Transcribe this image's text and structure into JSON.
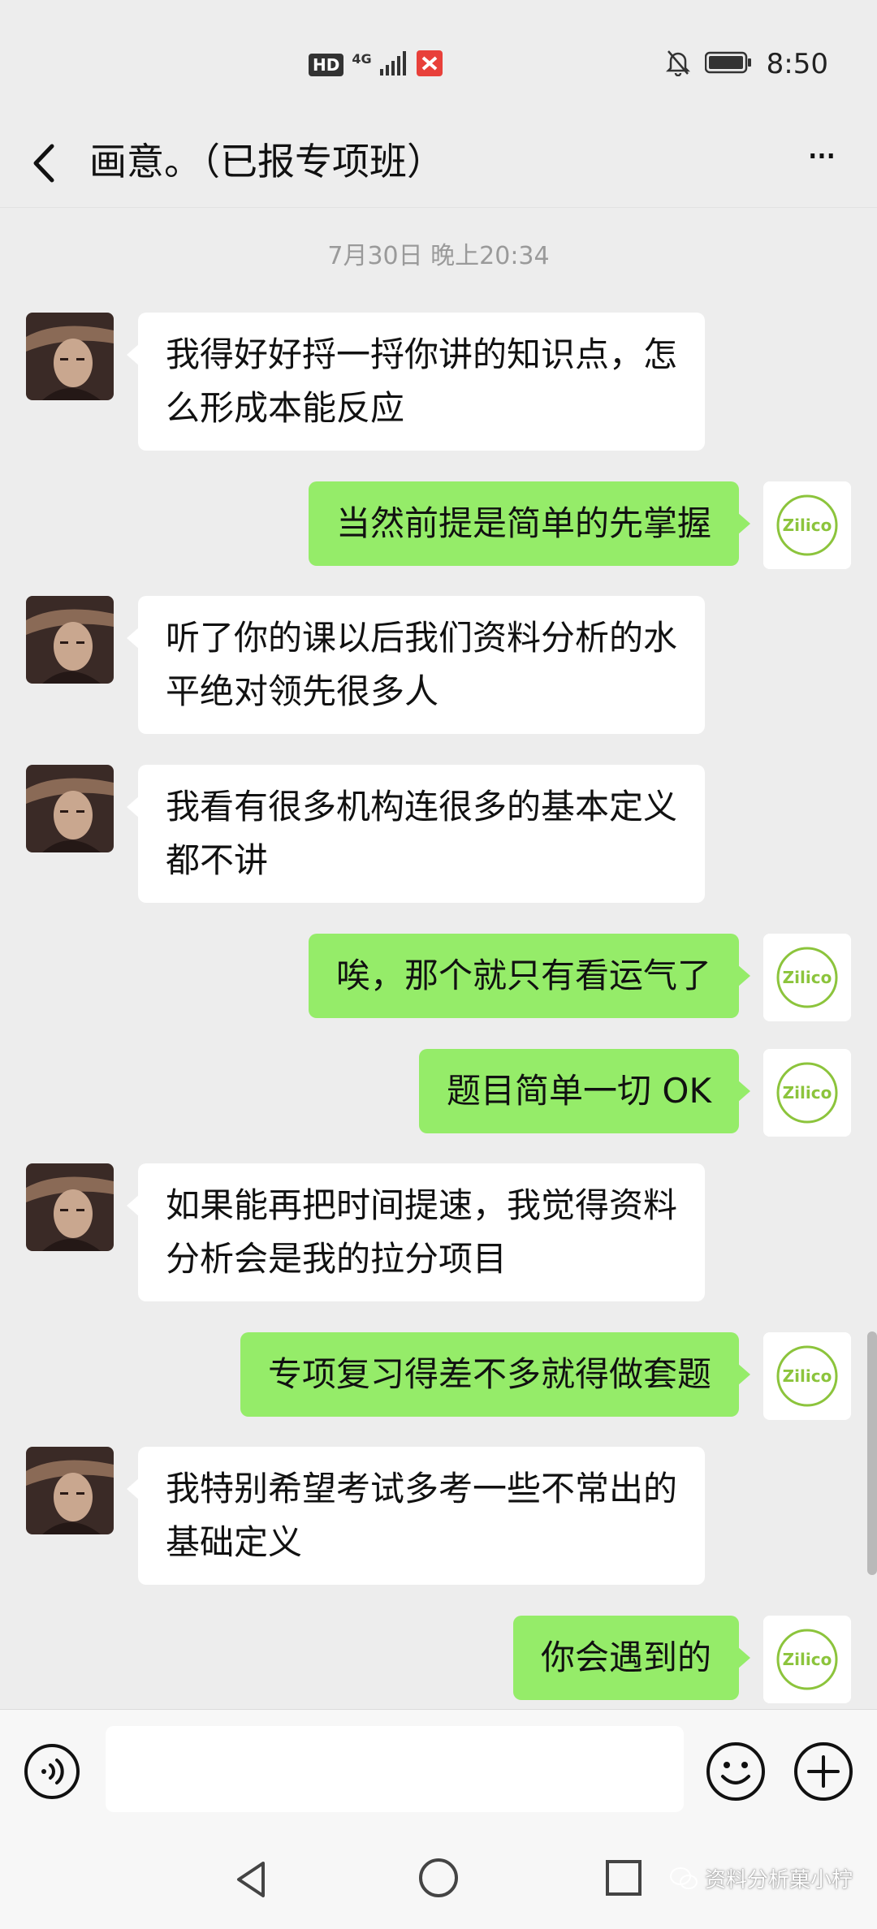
{
  "status_bar": {
    "hd_badge": "HD",
    "network_type": "4G",
    "time": "8:50",
    "icons": [
      "signal-icon",
      "shield-app-icon",
      "bell-off-icon",
      "battery-icon"
    ]
  },
  "header": {
    "title": "画意。（已报专项班）",
    "back_icon": "chevron-left-icon",
    "more_icon": "more-dots-icon",
    "more_label": "···"
  },
  "chat": {
    "timestamp": "7月30日 晚上20:34",
    "messages": [
      {
        "side": "in",
        "lines": [
          "我得好好捋一捋你讲的知识点，怎",
          "么形成本能反应"
        ]
      },
      {
        "side": "out",
        "lines": [
          "当然前提是简单的先掌握"
        ]
      },
      {
        "side": "in",
        "lines": [
          "听了你的课以后我们资料分析的水",
          "平绝对领先很多人"
        ]
      },
      {
        "side": "in",
        "lines": [
          "我看有很多机构连很多的基本定义",
          "都不讲"
        ]
      },
      {
        "side": "out",
        "lines": [
          "唉，那个就只有看运气了"
        ]
      },
      {
        "side": "out",
        "lines": [
          "题目简单一切 OK"
        ]
      },
      {
        "side": "in",
        "lines": [
          "如果能再把时间提速，我觉得资料",
          "分析会是我的拉分项目"
        ]
      },
      {
        "side": "out",
        "lines": [
          "专项复习得差不多就得做套题"
        ]
      },
      {
        "side": "in",
        "lines": [
          "我特别希望考试多考一些不常出的",
          "基础定义"
        ]
      },
      {
        "side": "out",
        "lines": [
          "你会遇到的"
        ]
      }
    ],
    "self_avatar_text": "Zilico"
  },
  "input_bar": {
    "placeholder": "",
    "value": "",
    "voice_icon": "voice-icon",
    "emoji_icon": "emoji-icon",
    "plus_icon": "plus-icon"
  },
  "nav_bar": {
    "back_icon": "nav-back-icon",
    "home_icon": "nav-home-icon",
    "recent_icon": "nav-recent-icon"
  },
  "watermark": {
    "text": "资料分析菓小柠"
  },
  "colors": {
    "background": "#ededed",
    "incoming_bubble": "#ffffff",
    "outgoing_bubble": "#95ec69",
    "timestamp": "#9a9a9a",
    "self_avatar_accent": "#8cc43c"
  }
}
